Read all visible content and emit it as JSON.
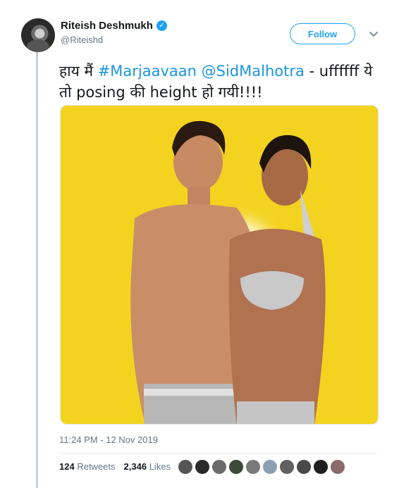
{
  "author": {
    "display_name": "Riteish Deshmukh",
    "handle": "@Riteishd",
    "verified_icon": "✓"
  },
  "follow_label": "Follow",
  "tweet": {
    "text_prefix": "हाय मैं ",
    "hashtag": "#Marjaavaan",
    "mention": "@SidMalhotra",
    "text_suffix": " - uffffff ये तो posing की height हो गयी!!!!"
  },
  "timestamp": "11:24 PM - 12 Nov 2019",
  "stats": {
    "retweets_count": "124",
    "retweets_label": "Retweets",
    "likes_count": "2,346",
    "likes_label": "Likes"
  },
  "colors": {
    "accent": "#1da1f2",
    "media_background": "#f2d31e"
  },
  "likers": [
    "#555555",
    "#2a2a2a",
    "#6b6b6b",
    "#3d4a3a",
    "#7a7a7a",
    "#8aa0b2",
    "#606060",
    "#4a4a4a",
    "#1f1f1f",
    "#8a6a6a"
  ]
}
